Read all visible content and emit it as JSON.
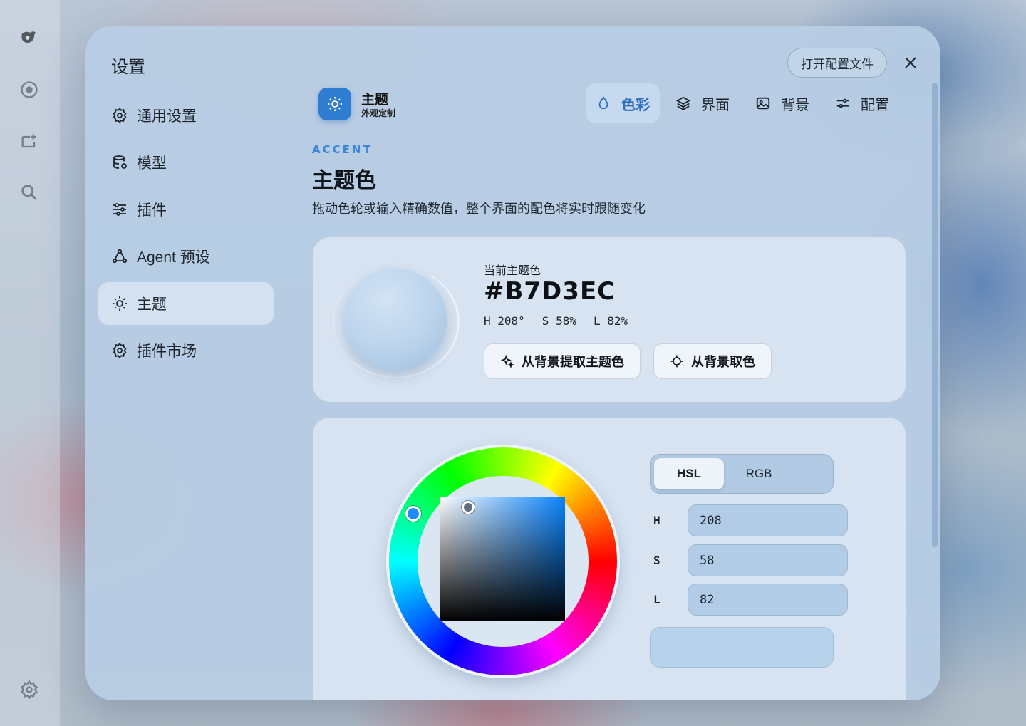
{
  "modal": {
    "title": "设置",
    "open_config_label": "打开配置文件"
  },
  "nav": {
    "items": [
      {
        "label": "通用设置",
        "icon": "gear-icon"
      },
      {
        "label": "模型",
        "icon": "database-icon"
      },
      {
        "label": "插件",
        "icon": "sliders-icon"
      },
      {
        "label": "Agent 预设",
        "icon": "recycle-icon"
      },
      {
        "label": "主题",
        "icon": "sun-icon",
        "active": true
      },
      {
        "label": "插件市场",
        "icon": "gear-icon"
      }
    ]
  },
  "header": {
    "title": "主题",
    "subtitle": "外观定制"
  },
  "tabs": [
    {
      "label": "色彩",
      "icon": "droplet-icon",
      "active": true
    },
    {
      "label": "界面",
      "icon": "layers-icon"
    },
    {
      "label": "背景",
      "icon": "image-icon"
    },
    {
      "label": "配置",
      "icon": "toggles-icon"
    }
  ],
  "section": {
    "eyebrow": "ACCENT",
    "title": "主题色",
    "description": "拖动色轮或输入精确数值，整个界面的配色将实时跟随变化"
  },
  "current": {
    "label": "当前主题色",
    "hex": "#B7D3EC",
    "h": "H 208°",
    "s": "S 58%",
    "l": "L 82%",
    "extract_button": "从背景提取主题色",
    "pick_button": "从背景取色"
  },
  "picker": {
    "modes": [
      "HSL",
      "RGB"
    ],
    "active_mode": "HSL",
    "fields": [
      {
        "label": "H",
        "value": "208"
      },
      {
        "label": "S",
        "value": "58"
      },
      {
        "label": "L",
        "value": "82"
      }
    ],
    "swatch_color": "#b7d3ec"
  },
  "colors": {
    "accent": "#3d86d6",
    "badge": "#2f7dd1"
  }
}
